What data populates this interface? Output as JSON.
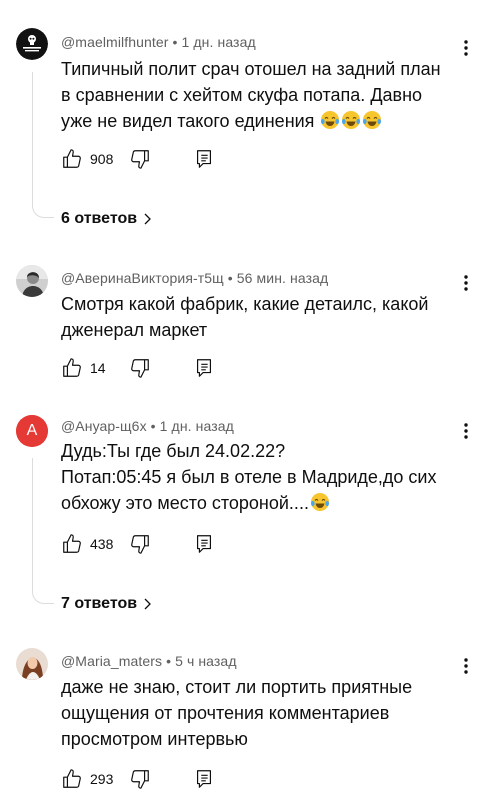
{
  "comments": [
    {
      "author": "@maelmilfhunter",
      "time": "1 дн. назад",
      "lines": [
        "Типичный полит срач отошел на задний план",
        "в сравнении с хейтом скуфа потапа. Давно",
        "уже не видел такого единения"
      ],
      "emoji_count": 3,
      "likes": "908",
      "replies": "6 ответов",
      "avatar": "skull-logo-avatar"
    },
    {
      "author": "@АверинаВиктория-т5щ",
      "time": "56 мин. назад",
      "lines": [
        "Смотря какой фабрик, какие детаилс, какой",
        "дженерал маркет"
      ],
      "likes": "14",
      "avatar": "photo-avatar"
    },
    {
      "author": "@Ануар-щ6х",
      "time": "1 дн. назад",
      "lines": [
        "Дудь:Ты где был 24.02.22?",
        "Потап:05:45 я был в отеле в Мадриде,до сих",
        "обхожу это место стороной...."
      ],
      "emoji_count": 1,
      "likes": "438",
      "replies": "7 ответов",
      "avatar": "letter-avatar",
      "avatar_letter": "А",
      "avatar_color": "#e53935"
    },
    {
      "author": "@Maria_maters",
      "time": "5 ч назад",
      "lines": [
        "даже не знаю, стоит ли портить приятные",
        "ощущения от прочтения комментариев",
        "просмотром интервью"
      ],
      "likes": "293",
      "avatar": "photo-avatar"
    }
  ],
  "icons": {
    "like": "thumb-up-icon",
    "dislike": "thumb-down-icon",
    "reply": "reply-icon",
    "menu": "more-vertical-icon",
    "emoji": "tears-of-joy-emoji",
    "chevron": "chevron-right-icon"
  }
}
